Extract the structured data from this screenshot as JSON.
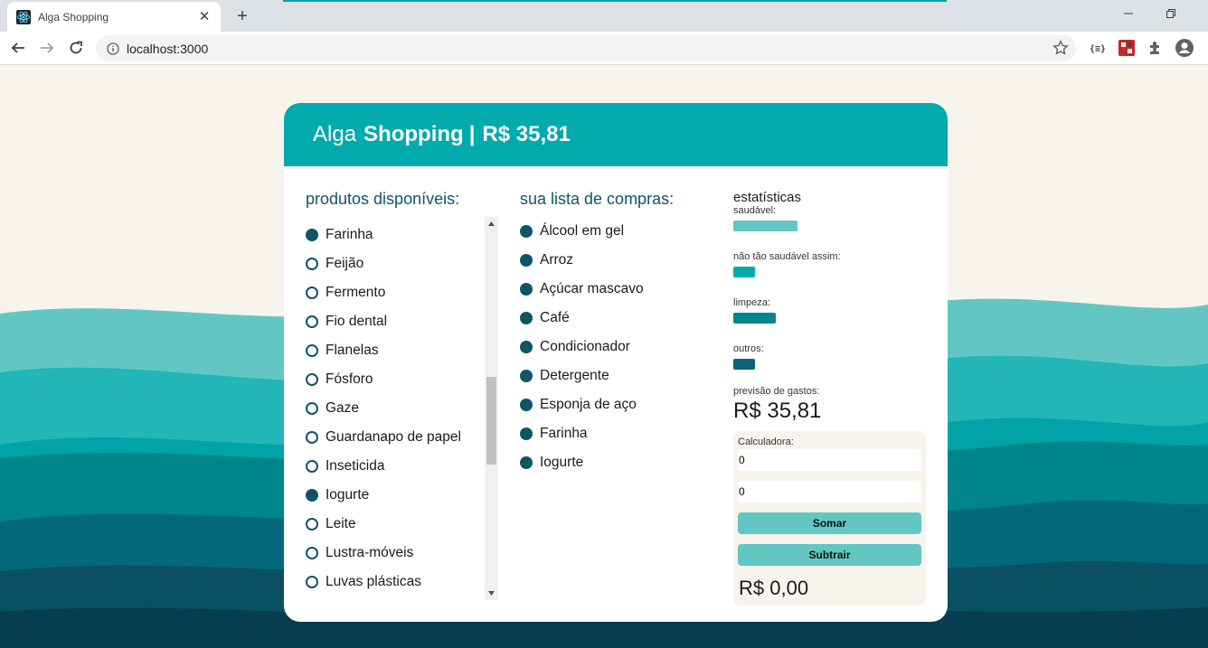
{
  "browser": {
    "tab_title": "Alga Shopping",
    "close_glyph": "✕",
    "new_tab_glyph": "+",
    "url": "localhost:3000"
  },
  "header": {
    "brand_light": "Alga",
    "brand_bold": "Shopping",
    "separator": "|",
    "total": "R$ 35,81"
  },
  "products": {
    "title": "produtos disponíveis:",
    "items": [
      {
        "label": "Farinha",
        "selected": true
      },
      {
        "label": "Feijão",
        "selected": false
      },
      {
        "label": "Fermento",
        "selected": false
      },
      {
        "label": "Fio dental",
        "selected": false
      },
      {
        "label": "Flanelas",
        "selected": false
      },
      {
        "label": "Fósforo",
        "selected": false
      },
      {
        "label": "Gaze",
        "selected": false
      },
      {
        "label": "Guardanapo de papel",
        "selected": false
      },
      {
        "label": "Inseticida",
        "selected": false
      },
      {
        "label": "Iogurte",
        "selected": true
      },
      {
        "label": "Leite",
        "selected": false
      },
      {
        "label": "Lustra-móveis",
        "selected": false
      },
      {
        "label": "Luvas plásticas",
        "selected": false
      }
    ]
  },
  "shopping_list": {
    "title": "sua lista de compras:",
    "items": [
      "Álcool em gel",
      "Arroz",
      "Açúcar mascavo",
      "Café",
      "Condicionador",
      "Detergente",
      "Esponja de aço",
      "Farinha",
      "Iogurte"
    ]
  },
  "stats": {
    "title": "estatísticas",
    "categories": [
      {
        "label": "saudável:",
        "level": 0.33,
        "color": "#62c7c3"
      },
      {
        "label": "não tão saudável assim:",
        "level": 0.11,
        "color": "#00aaad"
      },
      {
        "label": "limpeza:",
        "level": 0.22,
        "color": "#00868a"
      },
      {
        "label": "outros:",
        "level": 0.11,
        "color": "#0b6477"
      }
    ],
    "forecast_label": "previsão de gastos:",
    "forecast_value": "R$ 35,81"
  },
  "calculator": {
    "title": "Calculadora:",
    "input_a": "0",
    "input_b": "0",
    "add_label": "Somar",
    "subtract_label": "Subtrair",
    "result": "R$ 0,00"
  },
  "colors": {
    "primary": "#00aaad",
    "dark": "#0e5565",
    "background": "#f7f4ec",
    "button": "#62c7c3"
  }
}
